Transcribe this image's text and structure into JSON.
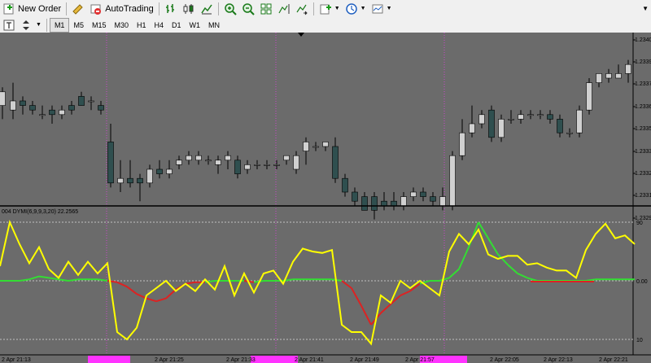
{
  "toolbar": {
    "new_order_label": "New Order",
    "auto_trading_label": "AutoTrading"
  },
  "timeframes": [
    "M1",
    "M5",
    "M15",
    "M30",
    "H1",
    "H4",
    "D1",
    "W1",
    "MN"
  ],
  "active_timeframe": "M1",
  "price_scale": [
    "1.2340",
    "1.2339",
    "1.2337",
    "1.2336",
    "1.2335",
    "1.2333",
    "1.2332",
    "1.2331",
    "1.2329"
  ],
  "indicator": {
    "label_prefix": "004",
    "label": "DYMI(6,9,9,3,20) 22.2565",
    "levels": [
      "90",
      "0.00",
      "10"
    ]
  },
  "time_axis_labels": [
    "2 Apr 21:13",
    "2 Apr 21:25",
    "2 Apr 21:33",
    "2 Apr 21:41",
    "2 Apr 21:49",
    "2 Apr 21:57",
    "2 Apr 22:05",
    "2 Apr 22:13",
    "2 Apr 22:21"
  ],
  "colors": {
    "background": "#6b6b6b",
    "bull_candle": "#d0d0d0",
    "bear_candle": "#2f4f4f",
    "wick": "#000000",
    "period_separator": "#cc44cc",
    "yellow_line": "#ffff00",
    "green_line": "#33dd33",
    "red_line": "#dd2222",
    "level_line": "#c0c0c0"
  },
  "candles": [
    [
      3,
      4,
      7,
      1,
      8
    ],
    [
      16,
      3,
      5,
      1,
      9
    ],
    [
      28,
      5,
      4,
      2,
      6
    ],
    [
      40,
      4,
      3,
      2,
      5
    ],
    [
      52,
      2,
      2,
      1,
      4
    ],
    [
      64,
      3,
      2,
      0,
      4
    ],
    [
      76,
      2,
      3,
      1,
      4
    ],
    [
      88,
      4,
      3,
      2,
      5
    ],
    [
      100,
      6,
      4,
      4,
      7
    ],
    [
      112,
      5,
      5,
      3,
      6
    ],
    [
      124,
      4,
      3,
      2,
      5
    ],
    [
      136,
      -4,
      -13,
      -14,
      0
    ],
    [
      148,
      -13,
      -12,
      -15,
      -8
    ],
    [
      160,
      -12,
      -13,
      -14,
      -8
    ],
    [
      172,
      -12,
      -13,
      -17,
      -11
    ],
    [
      184,
      -13,
      -10,
      -14,
      -9
    ],
    [
      196,
      -10,
      -11,
      -12,
      -8
    ],
    [
      208,
      -11,
      -10,
      -12,
      -8
    ],
    [
      220,
      -9,
      -8,
      -10,
      -7
    ],
    [
      232,
      -8,
      -7,
      -9,
      -6
    ],
    [
      244,
      -8,
      -7,
      -9,
      -6
    ],
    [
      256,
      -8,
      -8,
      -9,
      -7
    ],
    [
      268,
      -9,
      -8,
      -11,
      -7
    ],
    [
      280,
      -8,
      -7,
      -10,
      -6
    ],
    [
      292,
      -8,
      -11,
      -12,
      -7
    ],
    [
      304,
      -10,
      -9,
      -11,
      -8
    ],
    [
      316,
      -9,
      -9,
      -10,
      -8
    ],
    [
      328,
      -9,
      -9,
      -10,
      -8
    ],
    [
      340,
      -9,
      -9,
      -10,
      -8
    ],
    [
      352,
      -8,
      -7,
      -9,
      -7
    ],
    [
      364,
      -10,
      -7,
      -11,
      -6
    ],
    [
      376,
      -6,
      -4,
      -9,
      -3
    ],
    [
      388,
      -5,
      -5,
      -6,
      -4
    ],
    [
      400,
      -5,
      -4,
      -6,
      -4
    ],
    [
      412,
      -5,
      -12,
      -13,
      -3
    ],
    [
      424,
      -12,
      -15,
      -16,
      -11
    ],
    [
      436,
      -15,
      -17,
      -18,
      -14
    ],
    [
      448,
      -16,
      -19,
      -19,
      -15
    ],
    [
      460,
      -16,
      -19,
      -21,
      -15
    ],
    [
      472,
      -17,
      -18,
      -19,
      -15
    ],
    [
      484,
      -17,
      -18,
      -19,
      -15
    ],
    [
      496,
      -18,
      -16,
      -19,
      -15
    ],
    [
      508,
      -16,
      -15,
      -17,
      -14
    ],
    [
      520,
      -15,
      -16,
      -17,
      -14
    ],
    [
      532,
      -16,
      -17,
      -18,
      -15
    ],
    [
      544,
      -18,
      -16,
      -19,
      -14
    ],
    [
      556,
      -18,
      -7,
      -19,
      -6
    ],
    [
      568,
      -7,
      -2,
      -8,
      1
    ],
    [
      580,
      -2,
      0,
      -3,
      4
    ],
    [
      592,
      0,
      2,
      -1,
      3
    ],
    [
      604,
      3,
      -3,
      -4,
      4
    ],
    [
      616,
      -3,
      1,
      -4,
      2
    ],
    [
      628,
      1,
      1,
      0,
      3
    ],
    [
      640,
      1,
      2,
      0,
      3
    ],
    [
      652,
      2,
      2,
      1,
      3
    ],
    [
      664,
      2,
      2,
      1,
      3
    ],
    [
      676,
      2,
      1,
      0,
      3
    ],
    [
      688,
      1,
      -2,
      -3,
      2
    ],
    [
      700,
      -2,
      -2,
      -3,
      -1
    ],
    [
      712,
      -2,
      3,
      -3,
      4
    ],
    [
      724,
      3,
      9,
      2,
      10
    ],
    [
      736,
      9,
      11,
      8,
      11
    ],
    [
      748,
      10,
      11,
      9,
      12
    ],
    [
      760,
      10,
      11,
      10,
      13
    ],
    [
      772,
      11,
      13,
      9,
      14
    ]
  ],
  "yellow_line": [
    [
      0,
      60
    ],
    [
      12,
      90
    ],
    [
      24,
      75
    ],
    [
      36,
      62
    ],
    [
      48,
      73
    ],
    [
      60,
      58
    ],
    [
      72,
      52
    ],
    [
      84,
      63
    ],
    [
      96,
      54
    ],
    [
      108,
      63
    ],
    [
      120,
      55
    ],
    [
      132,
      62
    ],
    [
      144,
      15
    ],
    [
      156,
      10
    ],
    [
      168,
      18
    ],
    [
      180,
      40
    ],
    [
      192,
      45
    ],
    [
      204,
      50
    ],
    [
      216,
      43
    ],
    [
      228,
      48
    ],
    [
      240,
      43
    ],
    [
      252,
      51
    ],
    [
      264,
      44
    ],
    [
      276,
      60
    ],
    [
      288,
      40
    ],
    [
      300,
      55
    ],
    [
      312,
      42
    ],
    [
      324,
      55
    ],
    [
      336,
      57
    ],
    [
      348,
      48
    ],
    [
      360,
      63
    ],
    [
      372,
      72
    ],
    [
      384,
      70
    ],
    [
      396,
      69
    ],
    [
      408,
      71
    ],
    [
      420,
      20
    ],
    [
      432,
      15
    ],
    [
      444,
      15
    ],
    [
      456,
      7
    ],
    [
      468,
      40
    ],
    [
      480,
      35
    ],
    [
      492,
      50
    ],
    [
      504,
      45
    ],
    [
      516,
      50
    ],
    [
      528,
      45
    ],
    [
      540,
      40
    ],
    [
      552,
      70
    ],
    [
      564,
      82
    ],
    [
      576,
      75
    ],
    [
      588,
      85
    ],
    [
      600,
      68
    ],
    [
      612,
      65
    ],
    [
      624,
      67
    ],
    [
      636,
      67
    ],
    [
      648,
      61
    ],
    [
      660,
      62
    ],
    [
      672,
      59
    ],
    [
      684,
      57
    ],
    [
      696,
      57
    ],
    [
      708,
      52
    ],
    [
      720,
      71
    ],
    [
      732,
      82
    ],
    [
      744,
      89
    ],
    [
      756,
      79
    ],
    [
      768,
      81
    ],
    [
      780,
      75
    ]
  ],
  "green_line": [
    [
      0,
      50
    ],
    [
      12,
      50
    ],
    [
      24,
      50
    ],
    [
      36,
      51
    ],
    [
      48,
      53
    ],
    [
      60,
      52
    ],
    [
      72,
      51
    ],
    [
      84,
      50
    ],
    [
      96,
      51
    ],
    [
      108,
      51
    ],
    [
      120,
      51
    ],
    [
      132,
      50
    ],
    [
      144,
      49
    ],
    [
      156,
      46
    ],
    [
      168,
      41
    ],
    [
      180,
      38
    ],
    [
      192,
      36
    ],
    [
      204,
      38
    ],
    [
      216,
      44
    ],
    [
      228,
      48
    ],
    [
      240,
      49
    ],
    [
      252,
      49
    ],
    [
      264,
      50
    ],
    [
      276,
      50
    ],
    [
      288,
      50
    ],
    [
      300,
      50
    ],
    [
      312,
      49
    ],
    [
      324,
      50
    ],
    [
      336,
      50
    ],
    [
      348,
      50
    ],
    [
      360,
      51
    ],
    [
      372,
      51
    ],
    [
      384,
      51
    ],
    [
      396,
      51
    ],
    [
      408,
      51
    ],
    [
      420,
      50
    ],
    [
      432,
      45
    ],
    [
      444,
      33
    ],
    [
      456,
      20
    ],
    [
      468,
      28
    ],
    [
      480,
      34
    ],
    [
      492,
      40
    ],
    [
      504,
      43
    ],
    [
      516,
      48
    ],
    [
      528,
      50
    ],
    [
      540,
      50
    ],
    [
      552,
      52
    ],
    [
      564,
      58
    ],
    [
      576,
      73
    ],
    [
      588,
      90
    ],
    [
      600,
      79
    ],
    [
      612,
      68
    ],
    [
      624,
      61
    ],
    [
      636,
      55
    ],
    [
      648,
      52
    ],
    [
      660,
      50
    ],
    [
      672,
      50
    ],
    [
      684,
      50
    ],
    [
      696,
      50
    ],
    [
      708,
      50
    ],
    [
      720,
      50
    ],
    [
      732,
      51
    ],
    [
      744,
      51
    ],
    [
      756,
      51
    ],
    [
      768,
      51
    ],
    [
      780,
      51
    ]
  ]
}
